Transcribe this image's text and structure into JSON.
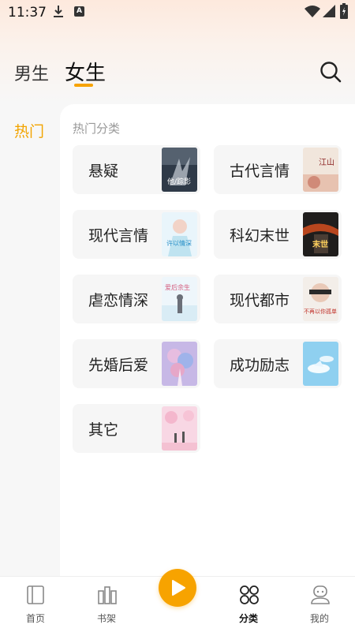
{
  "status_bar": {
    "time": "11:37",
    "notification_icons": [
      "download-icon",
      "a-app-icon"
    ],
    "system_icons": [
      "wifi-icon",
      "signal-icon",
      "battery-icon"
    ]
  },
  "header": {
    "tabs": [
      {
        "label": "男生",
        "selected": false
      },
      {
        "label": "女生",
        "selected": true
      }
    ],
    "accent_color": "#f7a300"
  },
  "sidebar": {
    "items": [
      {
        "label": "热门",
        "selected": true
      }
    ]
  },
  "main": {
    "section_title": "热门分类",
    "categories": [
      {
        "label": "悬疑",
        "cover_text": "他/踪影"
      },
      {
        "label": "古代言情",
        "cover_text": "江山"
      },
      {
        "label": "现代言情",
        "cover_text": "许以情深"
      },
      {
        "label": "科幻末世",
        "cover_text": "末世"
      },
      {
        "label": "虐恋情深",
        "cover_text": "爱后余生"
      },
      {
        "label": "现代都市",
        "cover_text": "不再以你孤单"
      },
      {
        "label": "先婚后爱",
        "cover_text": ""
      },
      {
        "label": "成功励志",
        "cover_text": ""
      },
      {
        "label": "其它",
        "cover_text": ""
      }
    ]
  },
  "bottom_nav": {
    "items": [
      {
        "label": "首页",
        "icon": "book-icon",
        "active": false
      },
      {
        "label": "书架",
        "icon": "bookshelf-icon",
        "active": false
      },
      {
        "label": "",
        "icon": "play-icon",
        "active": false
      },
      {
        "label": "分类",
        "icon": "category-icon",
        "active": true
      },
      {
        "label": "我的",
        "icon": "profile-icon",
        "active": false
      }
    ]
  }
}
